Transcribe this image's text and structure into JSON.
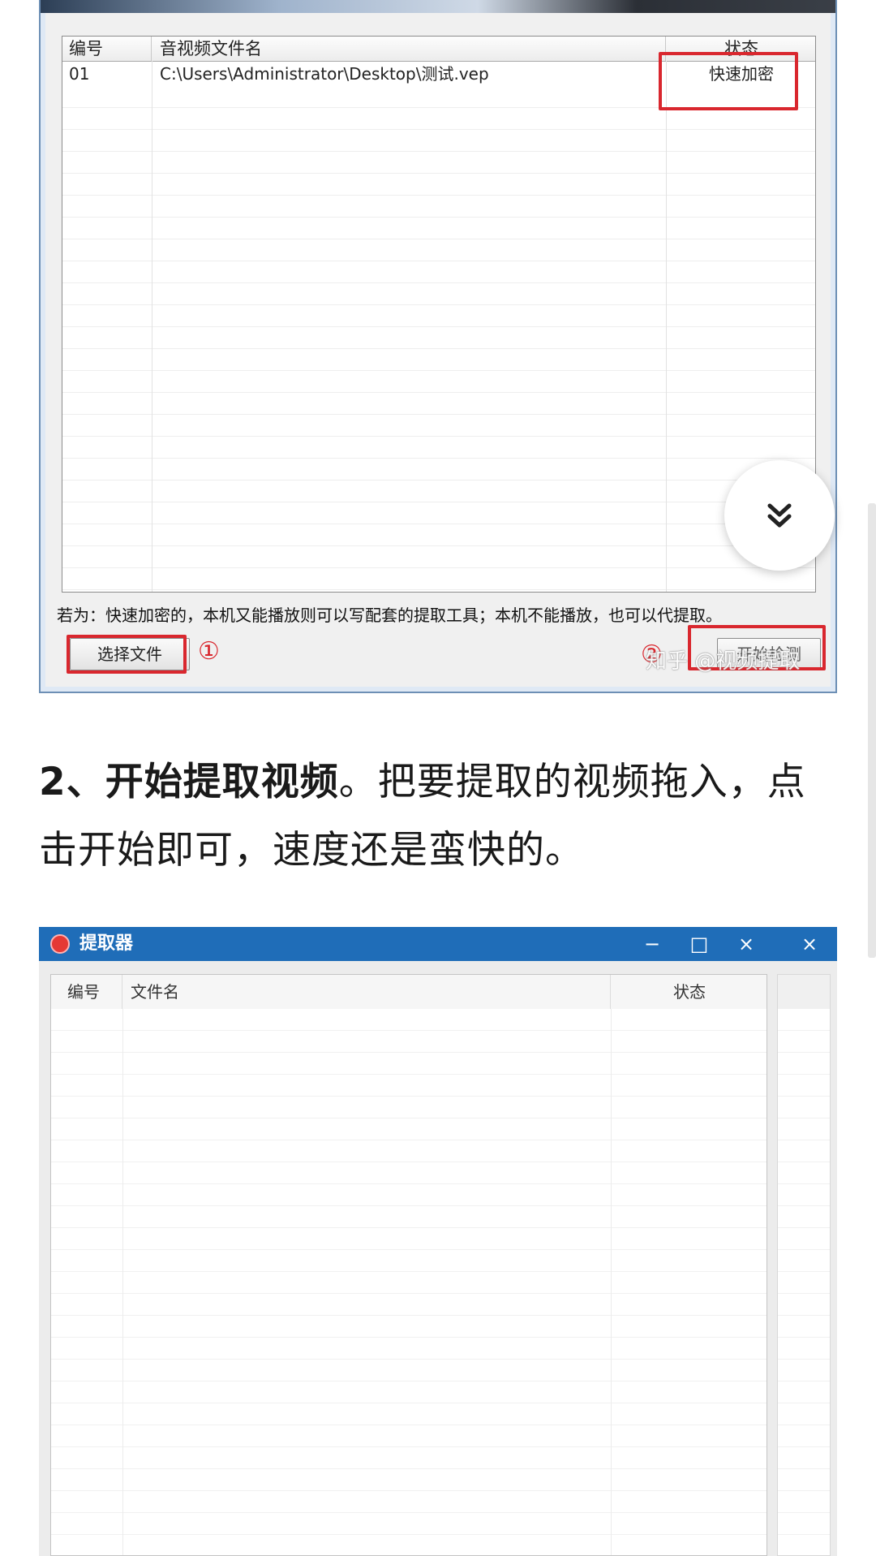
{
  "screenshot1": {
    "list": {
      "headers": [
        "编号",
        "音视频文件名",
        "状态"
      ],
      "rows": [
        {
          "id": "01",
          "filename": "C:\\Users\\Administrator\\Desktop\\测试.vep",
          "status": "快速加密"
        }
      ]
    },
    "notice": "若为：快速加密的，本机又能播放则可以写配套的提取工具；本机不能播放，也可以代提取。",
    "select_button": "选择文件",
    "start_button": "开始检测",
    "marker_1": "①",
    "marker_2": "②",
    "watermark": "知乎 @视频提取"
  },
  "fab": {
    "icon": "double-chevron-down-icon"
  },
  "article": {
    "bold_text": "2、开始提取视频",
    "body_text": "。把要提取的视频拖入，点击开始即可，速度还是蛮快的。"
  },
  "screenshot2": {
    "title": "提取器",
    "window_controls": [
      "−",
      "□",
      "×",
      "×"
    ],
    "list": {
      "headers": [
        "编号",
        "文件名",
        "状态"
      ]
    }
  },
  "colors": {
    "title_bar": "#1f6db8",
    "highlight_red": "#d9272e"
  }
}
